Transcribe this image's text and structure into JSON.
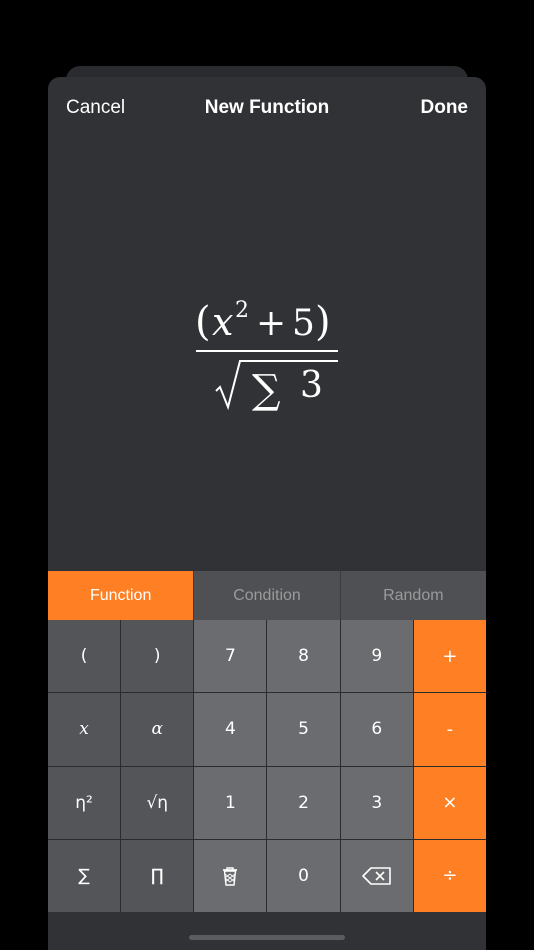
{
  "nav": {
    "cancel": "Cancel",
    "title": "New Function",
    "done": "Done"
  },
  "formula": {
    "latex": "\\frac{(x^2 + 5)}{\\sqrt{\\sum 3}}"
  },
  "tabs": [
    {
      "label": "Function",
      "active": true
    },
    {
      "label": "Condition",
      "active": false
    },
    {
      "label": "Random",
      "active": false
    }
  ],
  "keys": {
    "open_paren": "(",
    "close_paren": ")",
    "seven": "7",
    "eight": "8",
    "nine": "9",
    "plus": "+",
    "x": "x",
    "alpha": "α",
    "four": "4",
    "five": "5",
    "six": "6",
    "minus": "-",
    "eta_squared": "η²",
    "sqrt_eta": "√η",
    "one": "1",
    "two": "2",
    "three": "3",
    "times": "×",
    "sum": "∑",
    "product": "∏",
    "trash_icon": "trash-icon",
    "zero": "0",
    "backspace_icon": "backspace-icon",
    "divide": "÷"
  },
  "colors": {
    "accent": "#ff7f24",
    "sheet": "#313235",
    "background": "#000000"
  }
}
